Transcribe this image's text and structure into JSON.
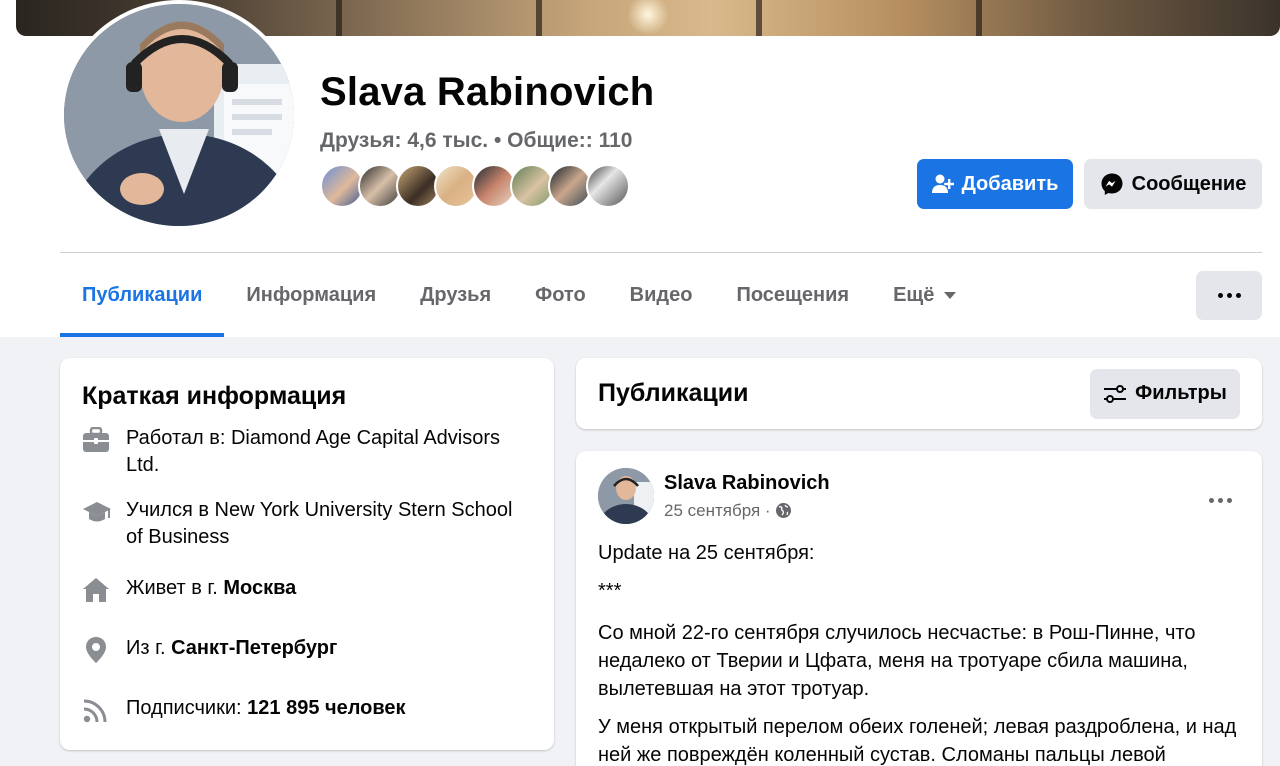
{
  "profile": {
    "name": "Slava Rabinovich",
    "friends_label": "Друзья: 4,6 тыс.",
    "separator": "•",
    "mutual_label": "Общие:: 110",
    "add_button": "Добавить",
    "message_button": "Сообщение"
  },
  "tabs": [
    {
      "label": "Публикации",
      "active": true
    },
    {
      "label": "Информация",
      "active": false
    },
    {
      "label": "Друзья",
      "active": false
    },
    {
      "label": "Фото",
      "active": false
    },
    {
      "label": "Видео",
      "active": false
    },
    {
      "label": "Посещения",
      "active": false
    },
    {
      "label": "Ещё",
      "active": false
    }
  ],
  "intro": {
    "title": "Краткая информация",
    "work_prefix": "Работал в: ",
    "work_value": "Diamond Age Capital Advisors Ltd.",
    "study_prefix": "Учился в ",
    "study_value": "New York University Stern School of Business",
    "lives_prefix": "Живет в г. ",
    "lives_value": "Москва",
    "from_prefix": "Из г. ",
    "from_value": "Санкт-Петербург",
    "followers_prefix": "Подписчики: ",
    "followers_value": "121 895 человек"
  },
  "posts_section": {
    "title": "Публикации",
    "filter_button": "Фильтры"
  },
  "post": {
    "author": "Slava Rabinovich",
    "date": "25 сентября",
    "date_sep": " · ",
    "line1": "Update на 25 сентября:",
    "line2": "***",
    "para1": "Со мной 22-го сентября случилось несчастье: в Рош-Пинне, что недалеко от Тверии и Цфата, меня на тротуаре сбила машина, вылетевшая на этот тротуар.",
    "para2": "У меня открытый перелом обеих голеней; левая раздроблена, и над ней же повреждён коленный сустав. Сломаны пальцы левой"
  },
  "icons": {
    "add_friend": "person-plus-icon",
    "messenger": "messenger-icon",
    "filters": "sliders-icon",
    "work": "briefcase-icon",
    "study": "graduation-cap-icon",
    "home": "house-icon",
    "location": "pin-icon",
    "rss": "rss-icon",
    "globe": "globe-icon",
    "more": "ellipsis-icon"
  },
  "colors": {
    "accent": "#1b74e4",
    "secondary_bg": "#e4e6eb",
    "muted_text": "#65676b",
    "page_bg": "#f0f2f5"
  }
}
